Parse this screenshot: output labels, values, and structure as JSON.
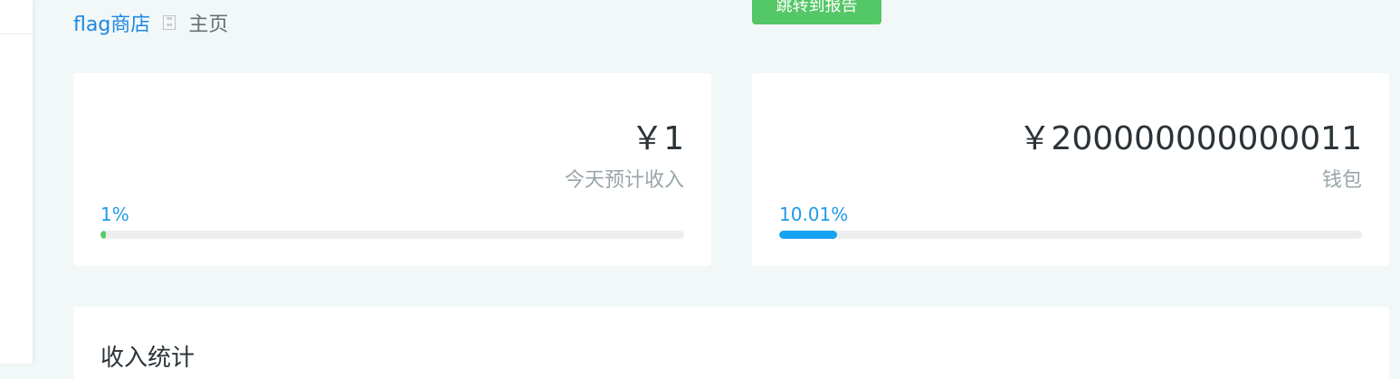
{
  "breadcrumb": {
    "shop_link": "flag商店",
    "separator_icon": "small-box-icon",
    "current": "主页"
  },
  "report_button": {
    "label": "跳转到报告",
    "color": "#54c766"
  },
  "cards": [
    {
      "amount": "￥1",
      "caption": "今天预计收入",
      "percent_label": "1%",
      "progress": 0.01,
      "bar_color": "#5cc86a"
    },
    {
      "amount": "￥200000000000011",
      "caption": "钱包",
      "percent_label": "10.01%",
      "progress": 0.1001,
      "bar_color": "#15a2f0"
    }
  ],
  "stats_panel": {
    "title": "收入统计"
  },
  "colors": {
    "page_bg": "#f2f7f8",
    "link": "#1e88e5",
    "percent_text": "#1e9be8"
  }
}
